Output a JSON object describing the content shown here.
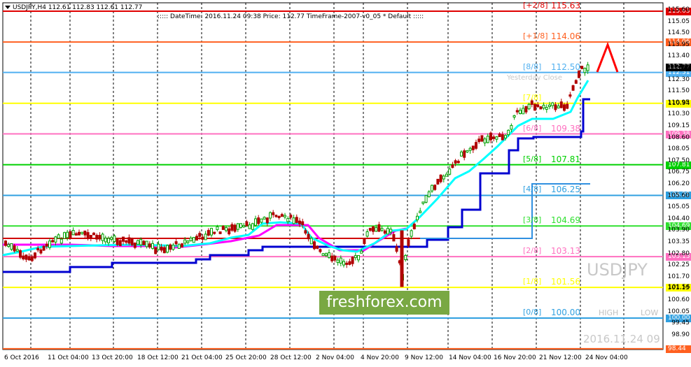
{
  "header": {
    "symbol_line": "USDJPY,H4  112.61 112.83 112.61 112.77",
    "info_line": "::::: DateTime: 2016.11.24 09:38    Price: 112.77    TimeFrame-2007-v0_05    *    Default    :::::"
  },
  "colors": {
    "background": "#ffffff",
    "bull_candle": "#00a000",
    "bear_candle": "#b00000",
    "cyan_line": "#00ffff",
    "blue_line": "#0000d0",
    "magenta_line": "#ff00ff",
    "logo_bg": "#79a843"
  },
  "murrey_levels": [
    {
      "label": "[+2/8]",
      "value": "115.63",
      "tag": "115.63",
      "color": "#e00000",
      "price": 115.63
    },
    {
      "label": "[+1/8]",
      "value": "114.06",
      "tag": "114.06",
      "color": "#ff6020",
      "price": 114.06
    },
    {
      "label": "[8/8]",
      "value": "112.50",
      "tag": "112.51",
      "color": "#50b0f0",
      "price": 112.51
    },
    {
      "label": "[7/8]",
      "value": "",
      "tag": "110.94",
      "color": "#ffff00",
      "price": 110.94
    },
    {
      "label": "[6/8]",
      "value": "109.38",
      "tag": "109.38",
      "color": "#ff70c0",
      "price": 109.38
    },
    {
      "label": "[5/8]",
      "value": "107.81",
      "tag": "107.81",
      "color": "#00d000",
      "price": 107.81
    },
    {
      "label": "[4/8]",
      "value": "106.25",
      "tag": "106.25",
      "color": "#30a0e0",
      "price": 106.25
    },
    {
      "label": "[3/8]",
      "value": "104.69",
      "tag": "104.69",
      "color": "#30e030",
      "price": 104.69
    },
    {
      "label": "[2/8]",
      "value": "103.13",
      "tag": "103.13",
      "color": "#ff70c0",
      "price": 103.13
    },
    {
      "label": "[1/8]",
      "value": "101.56",
      "tag": "101.56",
      "color": "#ffff00",
      "price": 101.56
    },
    {
      "label": "[0/8]",
      "value": "100.00",
      "tag": "100.00",
      "color": "#30a0e0",
      "price": 100.0
    },
    {
      "label": "",
      "value": "",
      "tag": "98.44",
      "color": "#ff6020",
      "price": 98.44
    }
  ],
  "price_axis": [
    "115.60",
    "115.05",
    "114.50",
    "113.95",
    "113.40",
    "112.77",
    "112.30",
    "111.50",
    "110.95",
    "110.30",
    "109.15",
    "108.60",
    "108.05",
    "107.50",
    "106.75",
    "106.20",
    "105.60",
    "105.05",
    "104.40",
    "103.90",
    "103.35",
    "102.80",
    "102.25",
    "101.70",
    "101.15",
    "100.60",
    "100.05",
    "99.45",
    "98.90"
  ],
  "current_price_tag": "112.77",
  "time_axis": [
    "6 Oct 2016",
    "11 Oct 04:00",
    "13 Oct 20:00",
    "18 Oct 12:00",
    "21 Oct 04:00",
    "25 Oct 20:00",
    "28 Oct 12:00",
    "2 Nov 04:00",
    "4 Nov 20:00",
    "9 Nov 12:00",
    "14 Nov 04:00",
    "16 Nov 20:00",
    "21 Nov 12:00",
    "24 Nov 04:00"
  ],
  "watermark_symbol": "USDJPY",
  "logo_text": "freshforex.com",
  "high_label": "HIGH",
  "low_label": "LOW",
  "timestamp": "2016.11.24 09",
  "yesterday_close_label": "Yesterday Close"
}
